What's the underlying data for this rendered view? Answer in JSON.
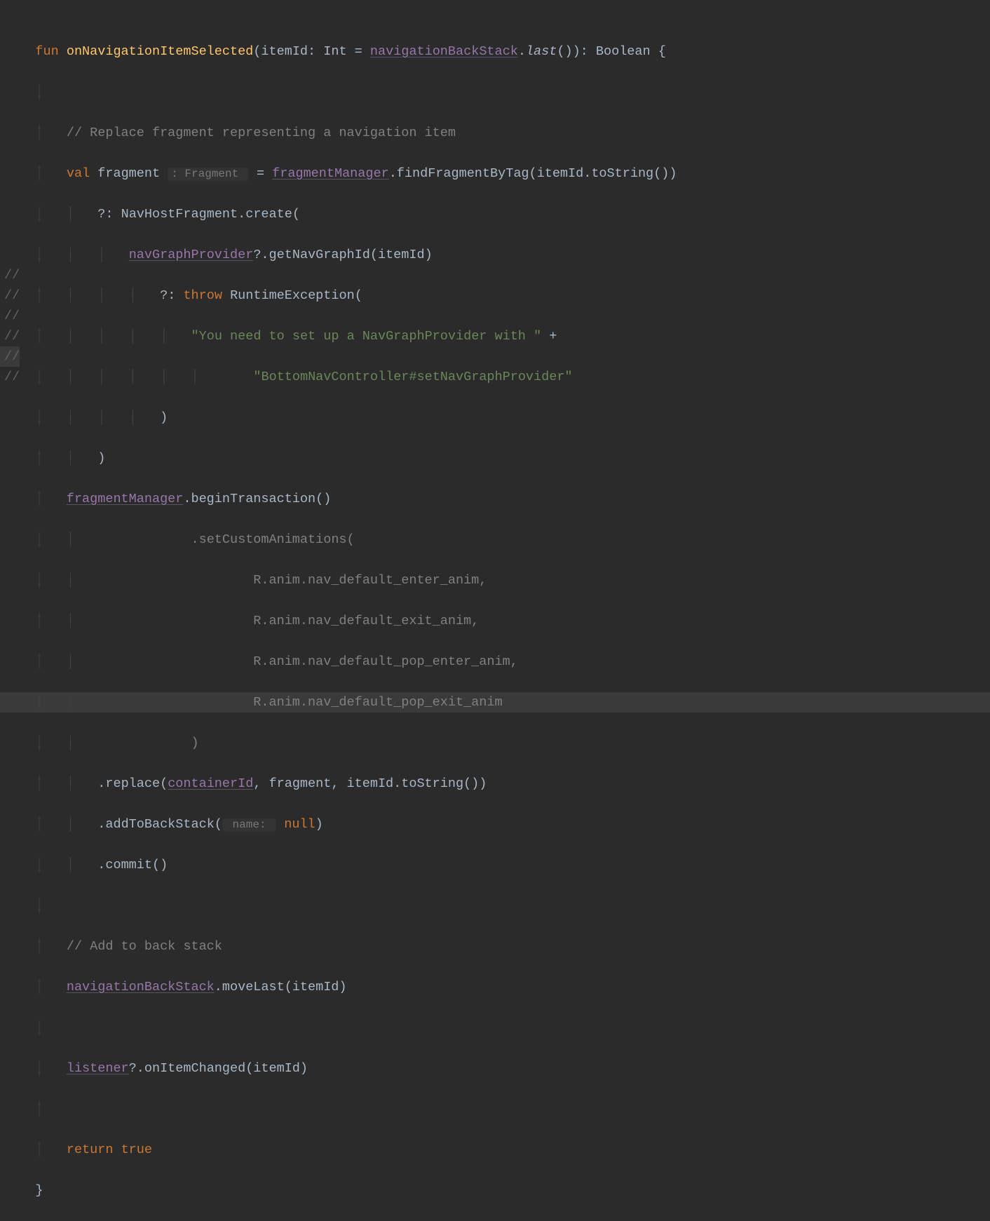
{
  "gutter": {
    "comment_marker": "//"
  },
  "code": {
    "l1": {
      "kw_fun": "fun",
      "fn_name": "onNavigationItemSelected",
      "open_paren": "(",
      "param": "itemId",
      "colon": ":",
      "type": "Int",
      "eq": "=",
      "field": "navigationBackStack",
      "dot": ".",
      "last": "last",
      "paren2": "())",
      "colon2": ":",
      "ret": "Boolean",
      "brace": "{"
    },
    "l3": {
      "comment": "// Replace fragment representing a navigation item"
    },
    "l4": {
      "kw_val": "val",
      "var": "fragment",
      "hint": ": Fragment ",
      "eq": "=",
      "field": "fragmentManager",
      "rest": ".findFragmentByTag(itemId.toString())"
    },
    "l5": {
      "elvis": "?:",
      "rest": "NavHostFragment.create("
    },
    "l6": {
      "field": "navGraphProvider",
      "rest": "?.getNavGraphId(itemId)"
    },
    "l7": {
      "elvis": "?:",
      "kw": "throw",
      "rest": "RuntimeException("
    },
    "l8": {
      "str": "\"You need to set up a NavGraphProvider with \"",
      "plus": "+"
    },
    "l9": {
      "str": "\"BottomNavController#setNavGraphProvider\""
    },
    "l10": {
      "paren": ")"
    },
    "l11": {
      "paren": ")"
    },
    "l12": {
      "field": "fragmentManager",
      "rest": ".beginTransaction()"
    },
    "l13": {
      "text": "            .setCustomAnimations("
    },
    "l14": {
      "text": "                    R.anim.nav_default_enter_anim,"
    },
    "l15": {
      "text": "                    R.anim.nav_default_exit_anim,"
    },
    "l16": {
      "text": "                    R.anim.nav_default_pop_enter_anim,"
    },
    "l17": {
      "text": "                    R.anim.nav_default_pop_exit_anim"
    },
    "l18": {
      "text": "            )"
    },
    "l19": {
      "replace": ".replace(",
      "field": "containerId",
      "rest": ", fragment, itemId.toString())"
    },
    "l20": {
      "add": ".addToBackStack(",
      "hint": " name: ",
      "kw": "null",
      "paren": ")"
    },
    "l21": {
      "commit": ".commit()"
    },
    "l23": {
      "comment": "// Add to back stack"
    },
    "l24": {
      "field": "navigationBackStack",
      "rest": ".moveLast(itemId)"
    },
    "l26": {
      "field": "listener",
      "rest": "?.onItemChanged(itemId)"
    },
    "l28": {
      "kw": "return",
      "val": "true"
    },
    "l29": {
      "brace": "}"
    }
  }
}
